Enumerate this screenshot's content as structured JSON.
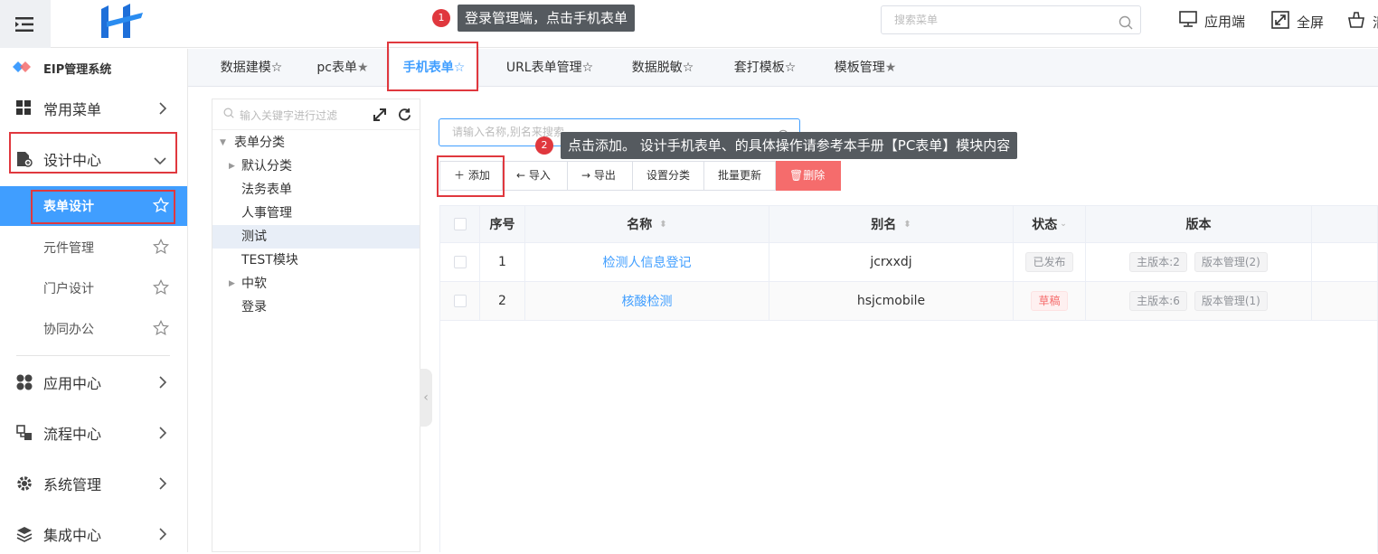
{
  "topbar": {
    "search_placeholder": "搜索菜单",
    "app_end": "应用端",
    "fullscreen": "全屏",
    "clear": "清"
  },
  "sidebar": {
    "system_title": "EIP管理系统",
    "menus": [
      {
        "label": "常用菜单",
        "icon": "grid-icon"
      },
      {
        "label": "设计中心",
        "icon": "design-doc-icon"
      },
      {
        "label": "应用中心",
        "icon": "apps-icon"
      },
      {
        "label": "流程中心",
        "icon": "flow-icon"
      },
      {
        "label": "系统管理",
        "icon": "gear-icon"
      },
      {
        "label": "集成中心",
        "icon": "layers-icon"
      }
    ],
    "submenus": [
      "表单设计",
      "元件管理",
      "门户设计",
      "协同办公"
    ]
  },
  "tabs": [
    "数据建模",
    "pc表单",
    "手机表单",
    "URL表单管理",
    "数据脱敏",
    "套打模板",
    "模板管理"
  ],
  "tree": {
    "filter_placeholder": "输入关键字进行过滤",
    "nodes": [
      "表单分类",
      "默认分类",
      "法务表单",
      "人事管理",
      "测试",
      "TEST模块",
      "中软",
      "登录"
    ]
  },
  "main": {
    "search_placeholder": "请输入名称,别名来搜索",
    "buttons": {
      "add": "添加",
      "import": "导入",
      "export": "导出",
      "set_category": "设置分类",
      "batch_update": "批量更新",
      "delete": "删除"
    },
    "columns": {
      "index": "序号",
      "name": "名称",
      "alias": "别名",
      "status": "状态",
      "version": "版本"
    },
    "rows": [
      {
        "index": "1",
        "name": "检测人信息登记",
        "alias": "jcrxxdj",
        "status": "已发布",
        "main_version": "主版本:2",
        "version_mgmt": "版本管理(2)"
      },
      {
        "index": "2",
        "name": "核酸检测",
        "alias": "hsjcmobile",
        "status": "草稿",
        "main_version": "主版本:6",
        "version_mgmt": "版本管理(1)"
      }
    ]
  },
  "annotations": [
    {
      "number": "1",
      "text": "登录管理端，点击手机表单"
    },
    {
      "number": "2",
      "text": "点击添加。 设计手机表单、的具体操作请参考本手册【PC表单】模块内容"
    }
  ],
  "colors": {
    "accent": "#409eff",
    "highlight": "#e0383e",
    "danger": "#f56c6c"
  }
}
